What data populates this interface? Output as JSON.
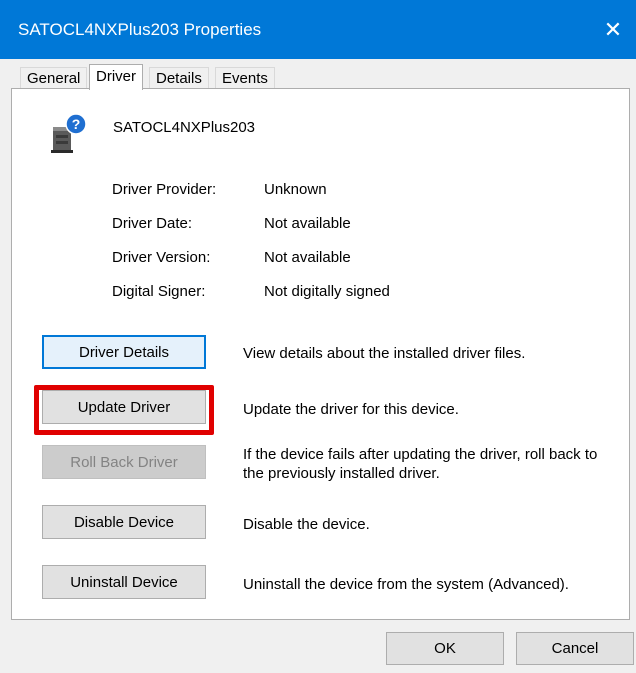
{
  "window": {
    "title": "SATOCL4NXPlus203  Properties",
    "close_glyph": "✕"
  },
  "tabs": [
    {
      "label": "General",
      "active": false
    },
    {
      "label": "Driver",
      "active": true
    },
    {
      "label": "Details",
      "active": false
    },
    {
      "label": "Events",
      "active": false
    }
  ],
  "device": {
    "icon": "unknown-device-icon",
    "name": "SATOCL4NXPlus203"
  },
  "properties": [
    {
      "label": "Driver Provider:",
      "value": "Unknown"
    },
    {
      "label": "Driver Date:",
      "value": "Not available"
    },
    {
      "label": "Driver Version:",
      "value": "Not available"
    },
    {
      "label": "Digital Signer:",
      "value": "Not digitally signed"
    }
  ],
  "actions": [
    {
      "label": "Driver Details",
      "description": "View details about the installed driver files.",
      "state": "focused"
    },
    {
      "label": "Update Driver",
      "description": "Update the driver for this device.",
      "state": "highlighted"
    },
    {
      "label": "Roll Back Driver",
      "description": "If the device fails after updating the driver, roll back to the previously installed driver.",
      "state": "disabled"
    },
    {
      "label": "Disable Device",
      "description": "Disable the device.",
      "state": "normal"
    },
    {
      "label": "Uninstall Device",
      "description": "Uninstall the device from the system (Advanced).",
      "state": "normal"
    }
  ],
  "footer": {
    "ok_label": "OK",
    "cancel_label": "Cancel"
  },
  "colors": {
    "titlebar": "#0078d7",
    "highlight_box": "#e00000",
    "focus_border": "#0078d7"
  }
}
